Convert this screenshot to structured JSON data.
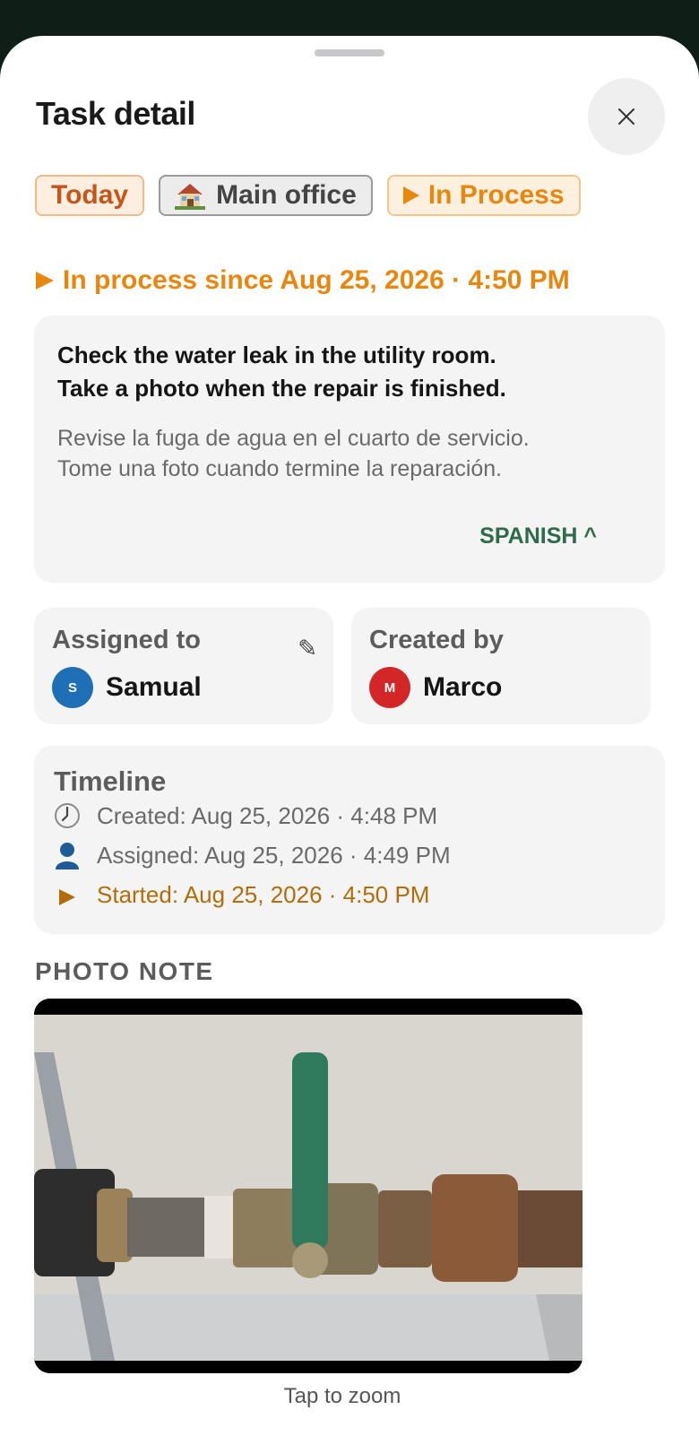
{
  "sheet": {
    "title": "Task detail"
  },
  "chips": {
    "today": "Today",
    "location": "Main office",
    "status": "In Process"
  },
  "status_line": "In process since Aug 25, 2026 · 4:50 PM",
  "instructions": {
    "english": "Check the water leak in the utility room.\nTake a photo when the repair is finished.",
    "translated": "Revise la fuga de agua en el cuarto de servicio.\nTome una foto cuando termine la reparación.",
    "language_toggle": "SPANISH ^"
  },
  "assigned": {
    "label": "Assigned to",
    "initial": "S",
    "name": "Samual",
    "avatar_color": "#1f6fb6"
  },
  "created": {
    "label": "Created by",
    "initial": "M",
    "name": "Marco",
    "avatar_color": "#d32727"
  },
  "timeline": {
    "title": "Timeline",
    "events": [
      {
        "icon": "clock-icon",
        "text": "Created: Aug 25, 2026 · 4:48 PM"
      },
      {
        "icon": "person-icon",
        "text": "Assigned: Aug 25, 2026 · 4:49 PM"
      },
      {
        "icon": "play-icon",
        "text": "Started: Aug 25, 2026 · 4:50 PM"
      }
    ]
  },
  "photo_note": {
    "label": "PHOTO NOTE",
    "caption": "Tap to zoom"
  },
  "colors": {
    "accent_orange": "#e8860e",
    "link_green": "#2e6b4a",
    "backdrop": "#0f1f17"
  }
}
